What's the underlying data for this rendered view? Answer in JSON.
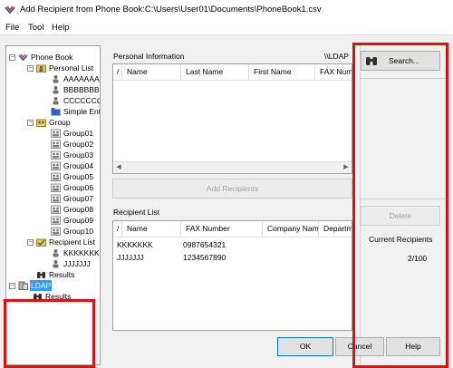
{
  "window": {
    "title": "Add Recipient from Phone Book:C:\\Users\\User01\\Documents\\PhoneBook1.csv"
  },
  "menu": {
    "file": "File",
    "tool": "Tool",
    "help": "Help"
  },
  "tree": {
    "phone_book": "Phone Book",
    "personal_list": "Personal List",
    "personal_items": [
      "AAAAAAA",
      "BBBBBBB",
      "CCCCCCC",
      "Simple Entry"
    ],
    "group": "Group",
    "groups": [
      "Group01",
      "Group02",
      "Group03",
      "Group04",
      "Group05",
      "Group06",
      "Group07",
      "Group08",
      "Group09",
      "Group10"
    ],
    "recipient_list": "Recipient List",
    "recipient_items": [
      "KKKKKKK",
      "JJJJJJJ"
    ],
    "results": "Results",
    "ldap": "LDAP",
    "ldap_results": "Results"
  },
  "personal_info": {
    "label": "Personal Information",
    "ldap_path": "\\\\LDAP",
    "columns": [
      "Name",
      "Last Name",
      "First Name",
      "FAX Numb"
    ]
  },
  "add_recipients_button": "Add Recipients",
  "recipient_list": {
    "label": "Recipient List",
    "columns": [
      "Name",
      "FAX Number",
      "Company Name",
      "Departmer"
    ],
    "rows": [
      {
        "name": "KKKKKKK",
        "fax": "0987654321"
      },
      {
        "name": "JJJJJJJ",
        "fax": "1234567890"
      }
    ]
  },
  "right_panel": {
    "search_button": "Search...",
    "delete_button": "Delete",
    "current_recipients_label": "Current Recipients",
    "current_recipients_value": "2/100"
  },
  "footer": {
    "ok": "OK",
    "cancel": "Cancel",
    "help": "Help"
  },
  "colors": {
    "highlight": "#e01010",
    "selection": "#3399ff"
  }
}
